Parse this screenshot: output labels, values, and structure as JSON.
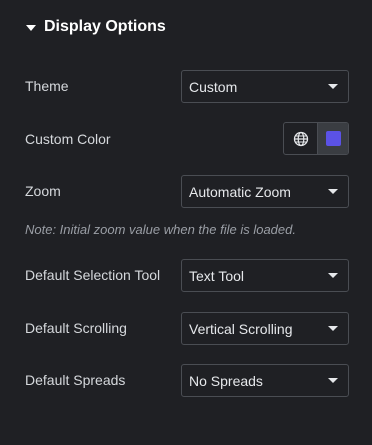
{
  "section": {
    "title": "Display Options"
  },
  "theme": {
    "label": "Theme",
    "value": "Custom"
  },
  "custom_color": {
    "label": "Custom Color",
    "swatch_color": "#5b52e6",
    "globe_icon": "globe-icon"
  },
  "zoom": {
    "label": "Zoom",
    "value": "Automatic Zoom",
    "note": "Note: Initial zoom value when the file is loaded."
  },
  "selection_tool": {
    "label": "Default Selection Tool",
    "value": "Text Tool"
  },
  "scrolling": {
    "label": "Default Scrolling",
    "value": "Vertical Scrolling"
  },
  "spreads": {
    "label": "Default Spreads",
    "value": "No Spreads"
  }
}
